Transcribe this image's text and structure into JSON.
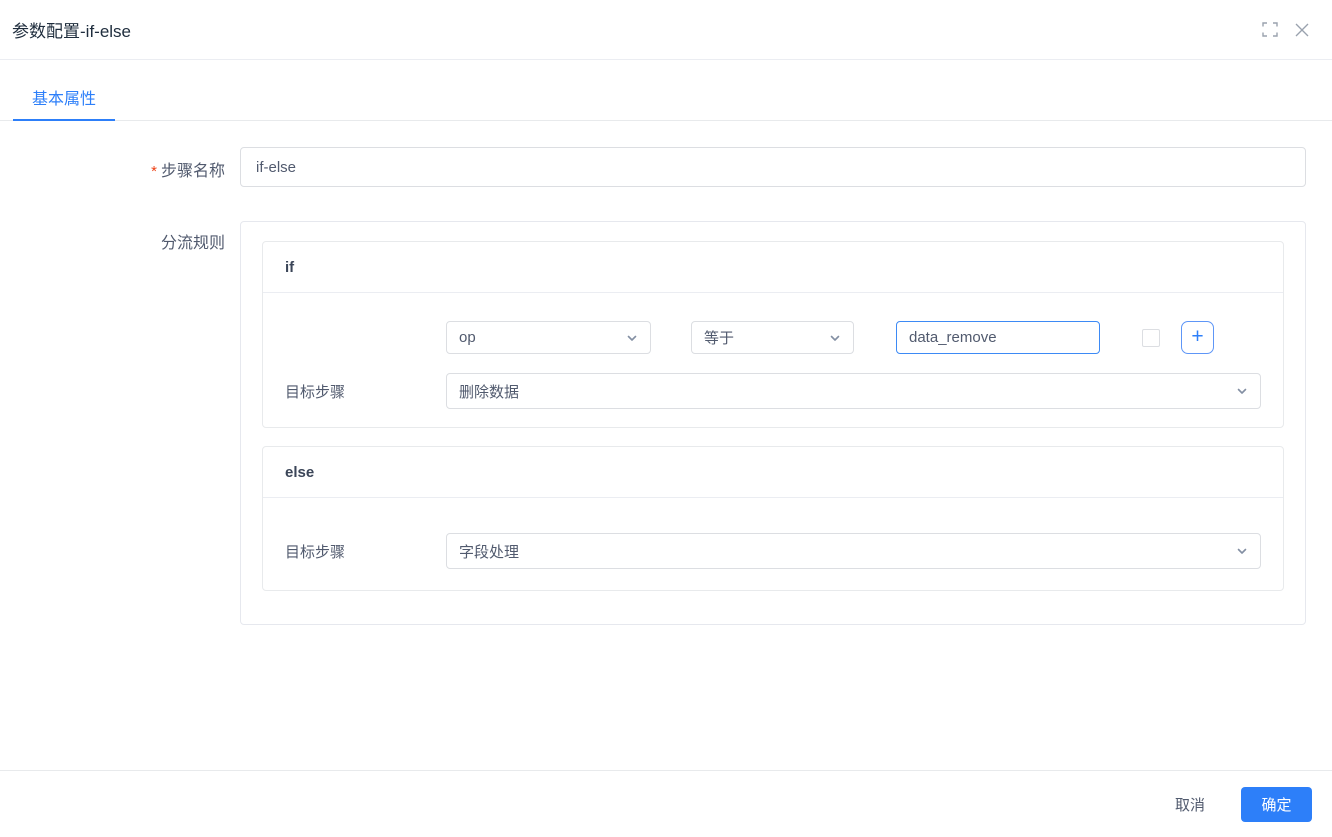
{
  "header": {
    "title": "参数配置-if-else"
  },
  "tabs": {
    "basic": "基本属性"
  },
  "form": {
    "step_name": {
      "required_mark": "*",
      "label": "步骤名称",
      "value": "if-else"
    },
    "branch_rules": {
      "label": "分流规则",
      "if": {
        "header": "if",
        "condition": {
          "field": "op",
          "operator": "等于",
          "value": "data_remove",
          "add_label": "+"
        },
        "target": {
          "label": "目标步骤",
          "value": "删除数据"
        }
      },
      "else": {
        "header": "else",
        "target": {
          "label": "目标步骤",
          "value": "字段处理"
        }
      }
    }
  },
  "footer": {
    "cancel": "取消",
    "confirm": "确定"
  },
  "icons": {
    "fullscreen": "fullscreen-icon",
    "close": "close-icon",
    "chevron": "chevron-down-icon"
  },
  "colors": {
    "accent": "#2d7ff9",
    "focused_border": "#3d8af5",
    "input_border": "#dcdee2",
    "card_border": "#e8eaec",
    "text": "#515a6e",
    "title_text": "#1f2d3d",
    "section_header_text": "#3b4558",
    "required": "#ed4014",
    "icon_gray": "#9aa2ae"
  }
}
